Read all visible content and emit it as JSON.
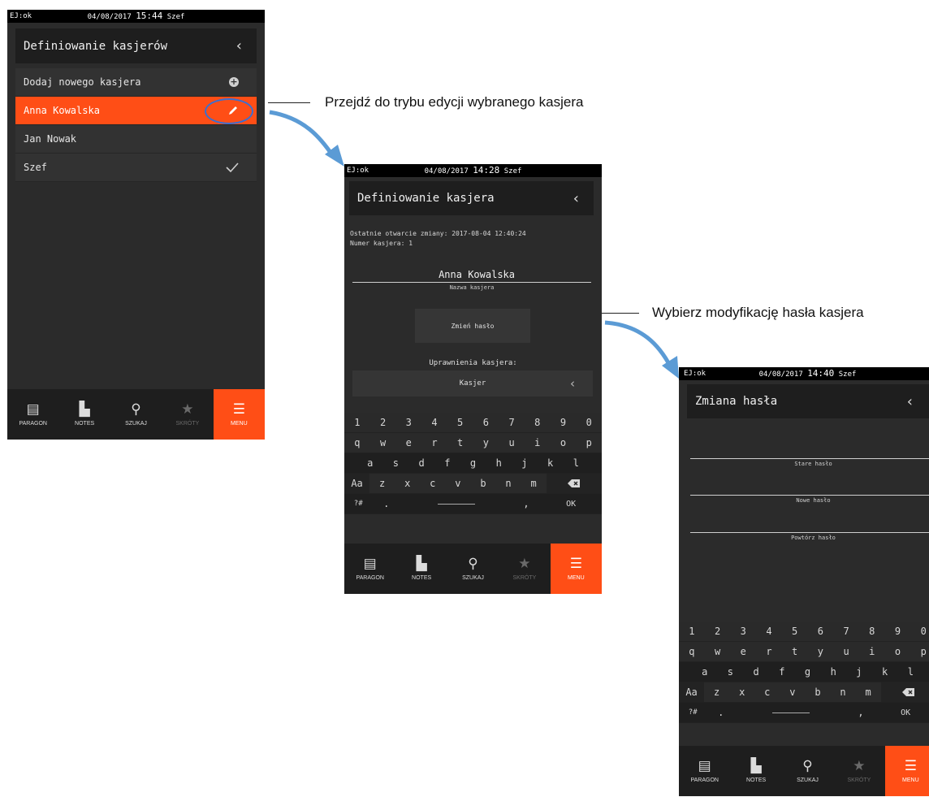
{
  "status": {
    "ej": "EJ:ok",
    "user": "Szef"
  },
  "screen1": {
    "date": "04/08/2017",
    "time": "15:44",
    "title": "Definiowanie kasjerów",
    "items": [
      {
        "label": "Dodaj nowego kasjera",
        "icon": "plus-circle-icon"
      },
      {
        "label": "Anna Kowalska",
        "icon": "pencil-icon",
        "selected": true
      },
      {
        "label": "Jan Nowak",
        "icon": ""
      },
      {
        "label": "Szef",
        "icon": "checkmark-icon"
      }
    ]
  },
  "screen2": {
    "date": "04/08/2017",
    "time": "14:28",
    "title": "Definiowanie kasjera",
    "info_line1": "Ostatnie otwarcie zmiany: 2017-08-04 12:40:24",
    "info_line2": "Numer kasjera: 1",
    "name_value": "Anna Kowalska",
    "name_caption": "Nazwa kasjera",
    "change_password": "Zmień hasło",
    "permissions_label": "Uprawnienia kasjera:",
    "permissions_value": "Kasjer"
  },
  "screen3": {
    "date": "04/08/2017",
    "time": "14:40",
    "title": "Zmiana hasła",
    "old_password": "Stare hasło",
    "new_password": "Nowe hasło",
    "repeat_password": "Powtórz hasło"
  },
  "keyboard": {
    "row1": [
      "1",
      "2",
      "3",
      "4",
      "5",
      "6",
      "7",
      "8",
      "9",
      "0"
    ],
    "row2": [
      "q",
      "w",
      "e",
      "r",
      "t",
      "y",
      "u",
      "i",
      "o",
      "p"
    ],
    "row3": [
      "a",
      "s",
      "d",
      "f",
      "g",
      "h",
      "j",
      "k",
      "l"
    ],
    "row4": [
      "z",
      "x",
      "c",
      "v",
      "b",
      "n",
      "m"
    ],
    "shift": "Aa",
    "symbols": "?#",
    "period": ".",
    "comma": ",",
    "ok": "OK"
  },
  "bottom_nav": {
    "paragon": "PARAGON",
    "notes": "NOTES",
    "szukaj": "SZUKAJ",
    "skroty": "SKRÓTY",
    "menu": "MENU"
  },
  "annotations": {
    "a1": "Przejdź do trybu edycji wybranego kasjera",
    "a2": "Wybierz modyfikację hasła kasjera"
  },
  "colors": {
    "accent": "#ff4e16",
    "screen_bg": "#2b2b2b",
    "arrow": "#5b9bd5",
    "highlight_ring": "#3b6fd0"
  }
}
